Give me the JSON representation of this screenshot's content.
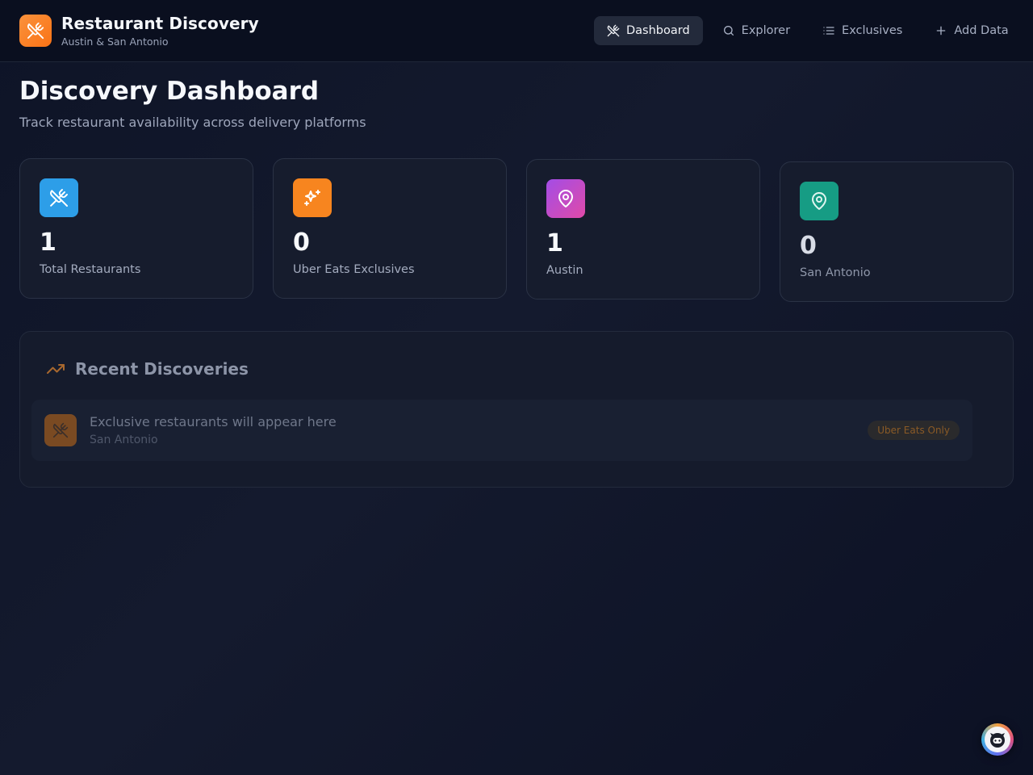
{
  "app": {
    "title": "Restaurant Discovery",
    "subtitle": "Austin & San Antonio",
    "logo_icon": "utensils-crossed-icon"
  },
  "nav": {
    "items": [
      {
        "label": "Dashboard",
        "icon": "utensils-crossed-icon",
        "active": true
      },
      {
        "label": "Explorer",
        "icon": "search-icon",
        "active": false
      },
      {
        "label": "Exclusives",
        "icon": "list-icon",
        "active": false
      },
      {
        "label": "Add Data",
        "icon": "plus-icon",
        "active": false
      }
    ]
  },
  "page": {
    "title": "Discovery Dashboard",
    "subtitle": "Track restaurant availability across delivery platforms"
  },
  "stats": [
    {
      "value": "1",
      "label": "Total Restaurants",
      "icon": "utensils-crossed-icon",
      "color": "#2d9ee8"
    },
    {
      "value": "0",
      "label": "Uber Eats Exclusives",
      "icon": "sparkles-icon",
      "color": "#f7851f"
    },
    {
      "value": "1",
      "label": "Austin",
      "icon": "map-pin-icon",
      "color": "#c04bd8"
    },
    {
      "value": "0",
      "label": "San Antonio",
      "icon": "map-pin-icon",
      "color": "#169c84"
    }
  ],
  "recent": {
    "title": "Recent Discoveries",
    "icon": "trending-up-icon",
    "items": [
      {
        "title": "Exclusive restaurants will appear here",
        "location": "San Antonio",
        "badge": "Uber Eats Only",
        "icon": "utensils-crossed-icon"
      }
    ]
  },
  "colors": {
    "accent": "#f97316",
    "background": "#0e1427"
  }
}
